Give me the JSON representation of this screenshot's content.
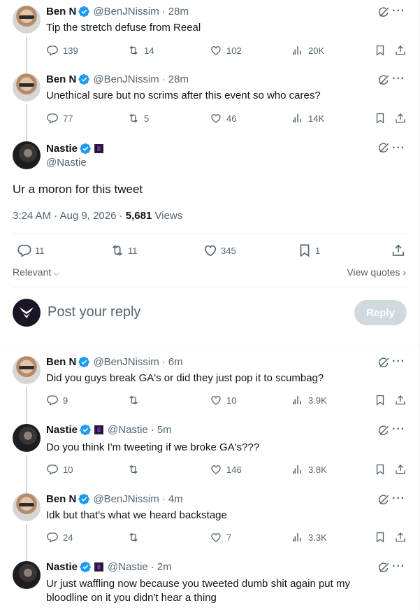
{
  "context_tweets": [
    {
      "name": "Ben N",
      "handle": "@BenJNissim",
      "time": "28m",
      "text": "Tip the stretch defuse from Reeal",
      "replies": "139",
      "retweets": "14",
      "likes": "102",
      "views": "20K"
    },
    {
      "name": "Ben N",
      "handle": "@BenJNissim",
      "time": "28m",
      "text": "Unethical sure but no scrims after this event so who cares?",
      "replies": "77",
      "retweets": "5",
      "likes": "46",
      "views": "14K"
    }
  ],
  "main_tweet": {
    "name": "Nastie",
    "handle": "@Nastie",
    "text": "Ur a moron for this tweet",
    "timestamp": "3:24 AM · Aug 9, 2026",
    "views_count": "5,681",
    "views_label": "Views",
    "replies": "11",
    "retweets": "11",
    "likes": "345",
    "bookmarks": "1"
  },
  "sort": {
    "label": "Relevant",
    "view_quotes": "View quotes"
  },
  "composer": {
    "placeholder": "Post your reply",
    "button": "Reply"
  },
  "replies": [
    {
      "name": "Ben N",
      "handle": "@BenJNissim",
      "time": "6m",
      "text": "Did you guys break GA's or did they just pop it to scumbag?",
      "replies": "9",
      "retweets": "",
      "likes": "10",
      "views": "3.9K"
    },
    {
      "name": "Nastie",
      "handle": "@Nastie",
      "time": "5m",
      "text": "Do you think I'm tweeting if we broke GA's???",
      "replies": "10",
      "retweets": "",
      "likes": "146",
      "views": "3.8K"
    },
    {
      "name": "Ben N",
      "handle": "@BenJNissim",
      "time": "4m",
      "text": "Idk but that's what we heard backstage",
      "replies": "24",
      "retweets": "",
      "likes": "7",
      "views": "3.3K"
    },
    {
      "name": "Nastie",
      "handle": "@Nastie",
      "time": "2m",
      "text": "Ur just waffling now because you tweeted dumb shit again put my bloodline on it you didn't hear a thing"
    }
  ],
  "colors": {
    "accent": "#1d9bf0",
    "secondary_text": "#536471",
    "border": "#eff3f4",
    "disabled_button": "#cfd9de"
  }
}
